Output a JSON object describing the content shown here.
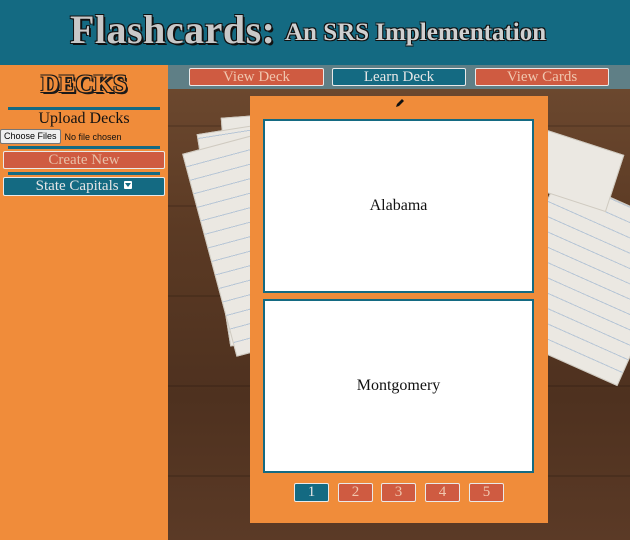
{
  "header": {
    "title": "Flashcards:",
    "subtitle": "An SRS Implementation"
  },
  "sidebar": {
    "title": "DECKS",
    "upload_label": "Upload Decks",
    "choose_files_label": "Choose Files",
    "no_file_text": "No file chosen",
    "create_new_label": "Create New",
    "selected_deck": "State Capitals"
  },
  "nav": {
    "view_deck": "View Deck",
    "learn_deck": "Learn Deck",
    "view_cards": "View Cards",
    "active": "Learn Deck"
  },
  "card": {
    "front": "Alabama",
    "back": "Montgomery"
  },
  "pagination": {
    "pages": [
      "1",
      "2",
      "3",
      "4",
      "5"
    ],
    "active": "1"
  },
  "colors": {
    "teal": "#146a82",
    "orange": "#f08c3a",
    "red": "#cf5b41"
  }
}
